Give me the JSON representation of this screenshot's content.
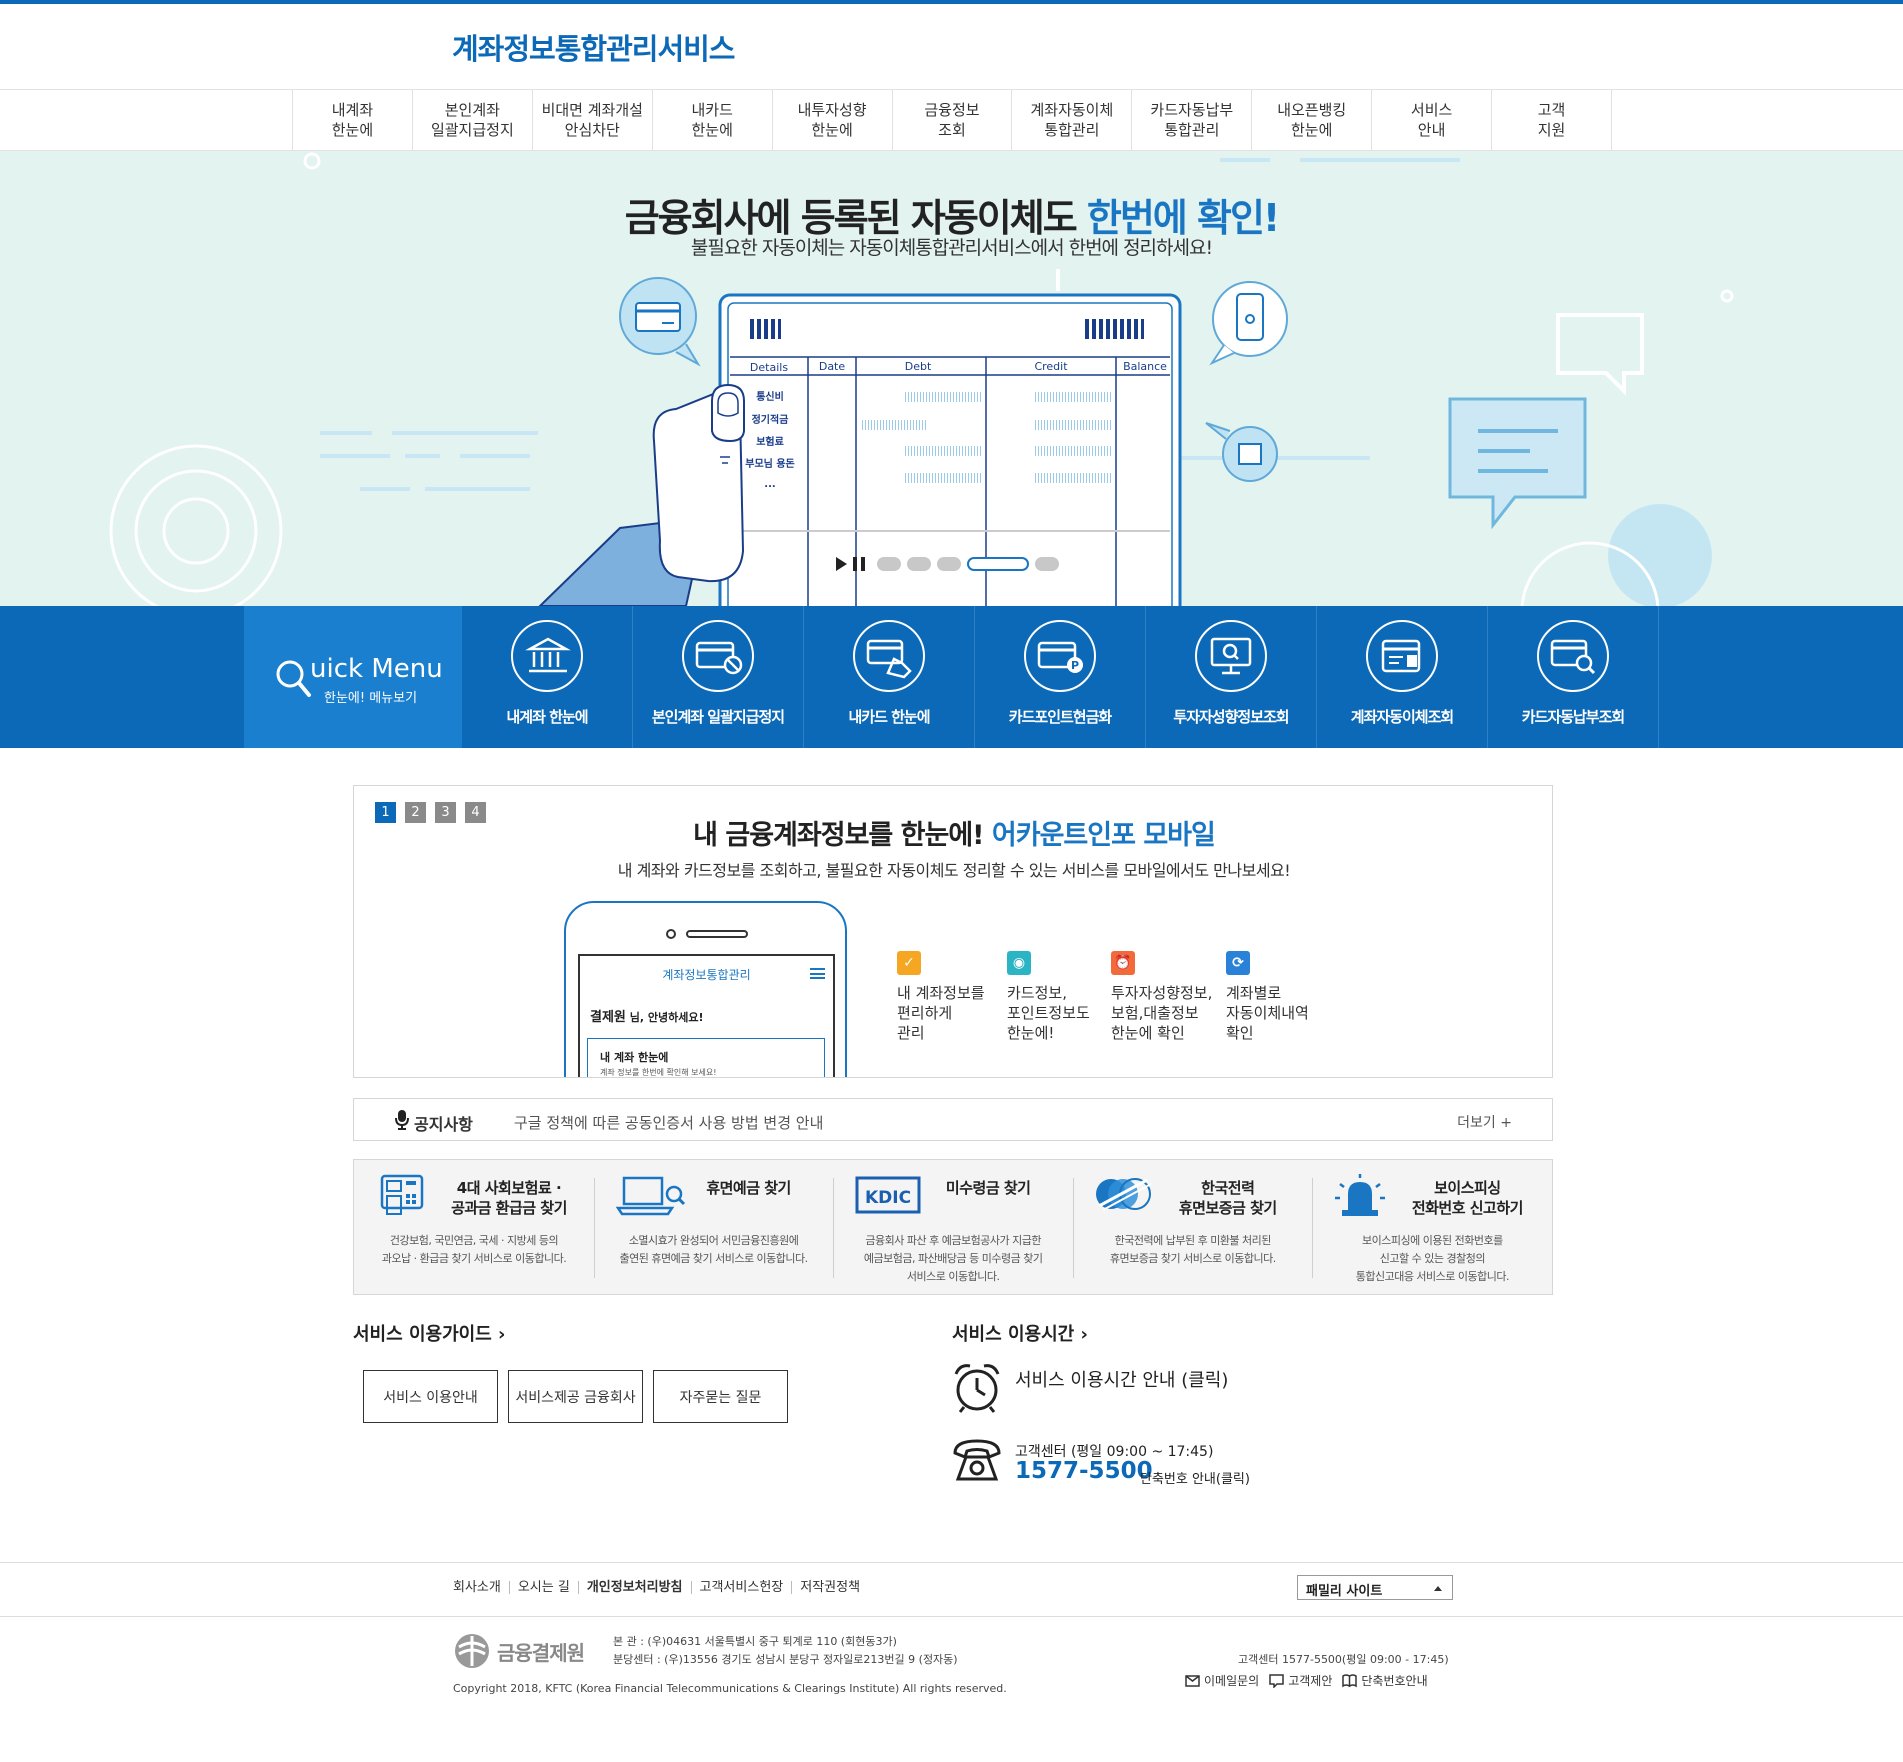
{
  "header": {
    "site_title": "계좌정보통합관리서비스"
  },
  "gnb": [
    "내계좌\n한눈에",
    "본인계좌\n일괄지급정지",
    "비대면 계좌개설\n안심차단",
    "내카드\n한눈에",
    "내투자성향\n한눈에",
    "금융정보\n조회",
    "계좌자동이체\n통합관리",
    "카드자동납부\n통합관리",
    "내오픈뱅킹\n한눈에",
    "서비스\n안내",
    "고객\n지원"
  ],
  "hero": {
    "title_part1": "금융회사에 등록된 자동이체도 ",
    "title_highlight": "한번에 확인!",
    "subtitle": "불필요한 자동이체는 자동이체통합관리서비스에서 한번에 정리하세요!",
    "table_headers": [
      "Details",
      "Date",
      "Debt",
      "Credit",
      "Balance"
    ],
    "table_rows": [
      "통신비",
      "정기적금",
      "보험료",
      "부모님 용돈",
      "..."
    ]
  },
  "quick_menu": {
    "title": "uick Menu",
    "subtitle": "한눈에! 메뉴보기",
    "items": [
      {
        "label": "내계좌 한눈에",
        "icon": "bank-icon"
      },
      {
        "label": "본인계좌 일괄지급정지",
        "icon": "card-block-icon"
      },
      {
        "label": "내카드 한눈에",
        "icon": "card-hand-icon"
      },
      {
        "label": "카드포인트현금화",
        "icon": "card-point-icon"
      },
      {
        "label": "투자자성향정보조회",
        "icon": "monitor-search-icon"
      },
      {
        "label": "계좌자동이체조회",
        "icon": "account-transfer-icon"
      },
      {
        "label": "카드자동납부조회",
        "icon": "card-search-icon"
      }
    ]
  },
  "promo": {
    "pages": [
      "1",
      "2",
      "3",
      "4"
    ],
    "title_part1": "내 금융계좌정보를 한눈에! ",
    "title_highlight": "어카운트인포 모바일",
    "subtitle": "내 계좌와 카드정보를 조회하고, 불필요한 자동이체도 정리할 수 있는 서비스를 모바일에서도 만나보세요!",
    "phone": {
      "app_title": "계좌정보통합관리",
      "greeting_name": "결제원",
      "greeting_suffix": " 님, 안녕하세요!",
      "card_title": "내 계좌 한눈에",
      "card_sub": "계좌 정보를 한번에 확인해 보세요!"
    },
    "features": [
      {
        "text": "내 계좌정보를\n편리하게\n관리",
        "color": "#f5a623",
        "glyph": "✓"
      },
      {
        "text": "카드정보,\n포인트정보도\n한눈에!",
        "color": "#2bb5c4",
        "glyph": "◉"
      },
      {
        "text": "투자자성향정보,\n보험,대출정보\n한눈에 확인",
        "color": "#f26a3a",
        "glyph": "⏰"
      },
      {
        "text": "계좌별로\n자동이체내역\n확인",
        "color": "#2a82d8",
        "glyph": "⟳"
      }
    ]
  },
  "notice": {
    "label": "공지사항",
    "text": "구글 정책에 따른 공동인증서 사용 방법 변경 안내",
    "more": "더보기 +"
  },
  "services": [
    {
      "title": "4대 사회보험료 ·\n공과금 환급금 찾기",
      "desc": "건강보험, 국민연금, 국세 · 지방세 등의\n과오납 · 환급금 찾기 서비스로 이동합니다.",
      "icon": "kiosk-icon"
    },
    {
      "title": "휴면예금 찾기",
      "desc": "소멸시효가 완성되어 서민금융진흥원에\n출연된 휴면예금 찾기 서비스로 이동합니다.",
      "icon": "laptop-search-icon"
    },
    {
      "title": "미수령금 찾기",
      "desc": "금융회사 파산 후 예금보험공사가 지급한\n예금보험금, 파산배당금 등 미수령금 찾기\n서비스로 이동합니다.",
      "icon": "kdic-logo-icon",
      "logo_text": "KDIC"
    },
    {
      "title": "한국전력\n휴면보증금 찾기",
      "desc": "한국전력에 납부된 후 미환불 처리된\n휴면보증금 찾기 서비스로 이동합니다.",
      "icon": "kepco-logo-icon"
    },
    {
      "title": "보이스피싱\n전화번호 신고하기",
      "desc": "보이스피싱에 이용된 전화번호를\n신고할 수 있는 경찰청의\n통합신고대응 서비스로 이동합니다.",
      "icon": "siren-icon"
    }
  ],
  "guide": {
    "title": "서비스 이용가이드",
    "buttons": [
      "서비스 이용안내",
      "서비스제공 금융회사",
      "자주묻는 질문"
    ]
  },
  "service_time": {
    "title": "서비스 이용시간",
    "link_text": "서비스 이용시간 안내 (클릭)",
    "cs_label": "고객센터 (평일 09:00 ~ 17:45)",
    "cs_phone": "1577-5500",
    "cs_link": "단축번호 안내(클릭)"
  },
  "footer": {
    "links": [
      "회사소개",
      "오시는 길",
      "개인정보처리방침",
      "고객서비스헌장",
      "저작권정책"
    ],
    "family_site": "패밀리 사이트",
    "org_name": "금융결제원",
    "address": "본        관 : (우)04631 서울특별시 중구 퇴계로 110 (회현동3가)\n분당센터 : (우)13556 경기도 성남시 분당구 정자일로213번길 9 (정자동)",
    "copyright": "Copyright 2018, KFTC (Korea Financial Telecommunications & Clearings Institute) All rights reserved.",
    "cs_info": "고객센터 1577-5500(평일 09:00 - 17:45)",
    "bottom_links": [
      "이메일문의",
      "고객제안",
      "단축번호안내"
    ]
  },
  "colors": {
    "brand": "#0b69b7",
    "hero_bg": "#e2f3f0",
    "highlight": "#1a76c2"
  }
}
